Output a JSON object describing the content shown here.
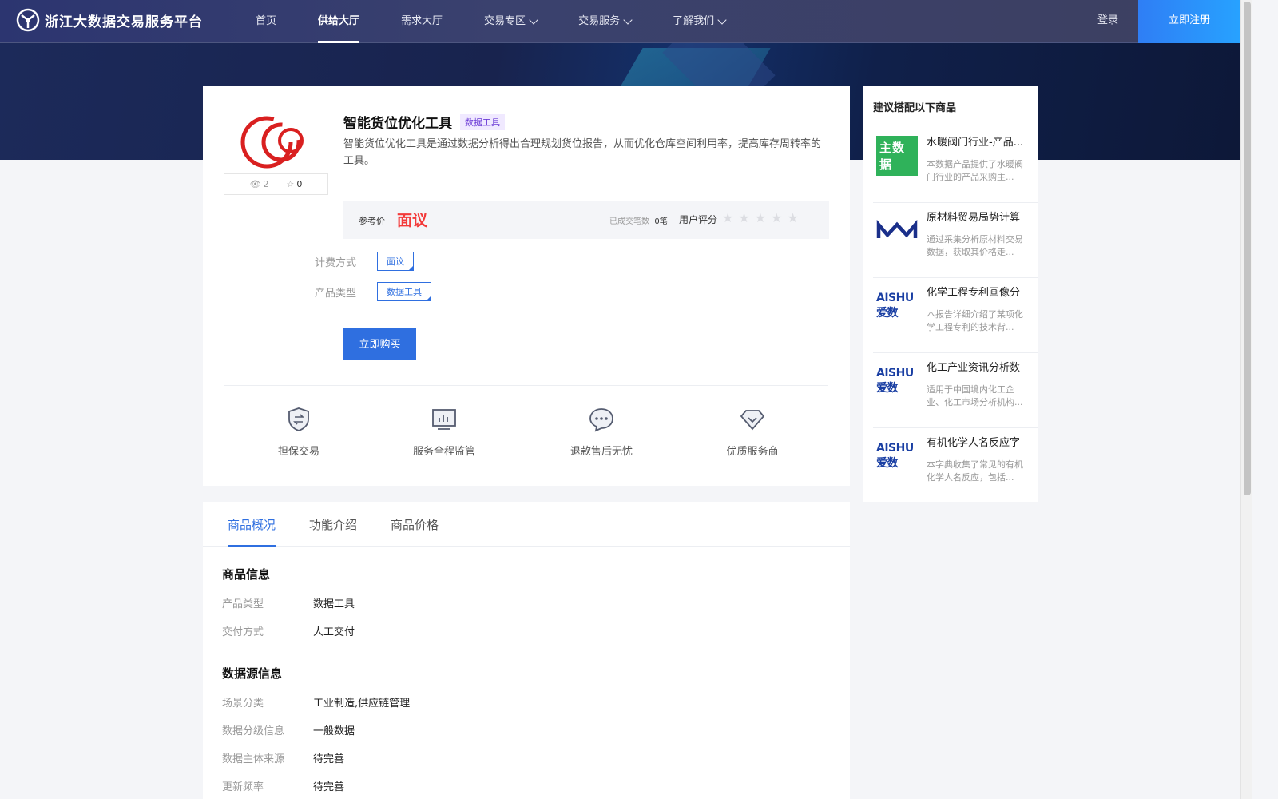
{
  "header": {
    "logo_text": "浙江大数据交易服务平台",
    "nav": [
      {
        "label": "首页",
        "dropdown": false,
        "active": false
      },
      {
        "label": "供给大厅",
        "dropdown": false,
        "active": true
      },
      {
        "label": "需求大厅",
        "dropdown": false,
        "active": false
      },
      {
        "label": "交易专区",
        "dropdown": true,
        "active": false
      },
      {
        "label": "交易服务",
        "dropdown": true,
        "active": false
      },
      {
        "label": "了解我们",
        "dropdown": true,
        "active": false
      }
    ],
    "login": "登录",
    "register": "立即注册"
  },
  "product": {
    "title": "智能货位优化工具",
    "tag": "数据工具",
    "description": "智能货位优化工具是通过数据分析得出合理规划货位报告，从而优化仓库空间利用率，提高库存周转率的工具。",
    "views": "2",
    "stars": "0",
    "price_label": "参考价",
    "price_value": "面议",
    "deals_label": "已成交笔数",
    "deals_value": "0笔",
    "rating_label": "用户评分",
    "rating_value": 0,
    "billing_label": "计费方式",
    "billing_value": "面议",
    "type_label": "产品类型",
    "type_value": "数据工具",
    "buy_button": "立即购买"
  },
  "guarantees": [
    {
      "label": "担保交易",
      "icon": "shield-exchange-icon"
    },
    {
      "label": "服务全程监管",
      "icon": "monitor-chart-icon"
    },
    {
      "label": "退款售后无忧",
      "icon": "chat-bubble-icon"
    },
    {
      "label": "优质服务商",
      "icon": "diamond-icon"
    }
  ],
  "side": {
    "title": "建议搭配以下商品",
    "items": [
      {
        "name": "水暖阀门行业-产品...",
        "desc": "本数据产品提供了水暖阀门行业的产品采购主...",
        "logo": "主数据"
      },
      {
        "name": "原材料贸易局势计算",
        "desc": "通过采集分析原材料交易数据，获取其价格走...",
        "logo": "wave-logo"
      },
      {
        "name": "化学工程专利画像分",
        "desc": "本报告详细介绍了某项化学工程专利的技术背...",
        "logo": "AISHU爱数"
      },
      {
        "name": "化工产业资讯分析数",
        "desc": "适用于中国境内化工企业、化工市场分析机构...",
        "logo": "AISHU爱数"
      },
      {
        "name": "有机化学人名反应字",
        "desc": "本字典收集了常见的有机化学人名反应，包括...",
        "logo": "AISHU爱数"
      }
    ]
  },
  "tabs": [
    "商品概况",
    "功能介绍",
    "商品价格"
  ],
  "overview": {
    "info_title": "商品信息",
    "info": [
      {
        "k": "产品类型",
        "v": "数据工具"
      },
      {
        "k": "交付方式",
        "v": "人工交付"
      }
    ],
    "source_title": "数据源信息",
    "source": [
      {
        "k": "场景分类",
        "v": "工业制造,供应链管理"
      },
      {
        "k": "数据分级信息",
        "v": "一般数据"
      },
      {
        "k": "数据主体来源",
        "v": "待完善"
      },
      {
        "k": "更新频率",
        "v": "待完善"
      }
    ]
  },
  "colors": {
    "accent": "#2f6fe0",
    "price": "#f33a3a",
    "tag_purple": "#6b3bd6"
  }
}
